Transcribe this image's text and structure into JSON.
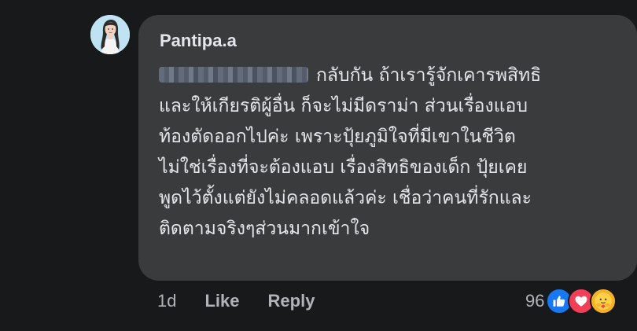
{
  "comment": {
    "author": "Pantipa.a",
    "lines": [
      "กลับกัน ถ้าเรารู้จักเคารพสิทธิ",
      "และให้เกียรติผู้อื่น ก็จะไม่มีดราม่า ส่วนเรื่องแอบ",
      "ท้องตัดออกไปค่ะ เพราะปุ้ยภูมิใจที่มีเขาในชีวิต",
      "ไม่ใช่เรื่องที่จะต้องแอบ เรื่องสิทธิของเด็ก ปุ้ยเคย",
      "พูดไว้ตั้งแต่ยังไม่คลอดแล้วค่ะ เชื่อว่าคนที่รักและ",
      "ติดตามจริงๆส่วนมากเข้าใจ"
    ]
  },
  "actions": {
    "timestamp": "1d",
    "like_label": "Like",
    "reply_label": "Reply"
  },
  "reactions": {
    "count": "96",
    "icons": [
      "thumbs-up-icon",
      "heart-icon",
      "care-icon"
    ],
    "colors": {
      "like": "#1877f2",
      "love": "#f33e58",
      "care": "#f7b125"
    }
  }
}
